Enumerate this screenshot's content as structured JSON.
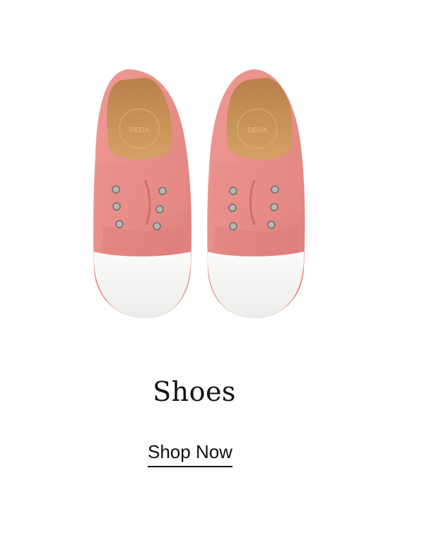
{
  "product": {
    "image_alt": "Pink canvas slip-on shoes with white toe caps",
    "logo_text": "DEDA"
  },
  "category": {
    "title": "Shoes",
    "cta_label": "Shop Now"
  },
  "colors": {
    "canvas": "#e88f8b",
    "toe_cap": "#f6f6f4",
    "lining": "#c99356"
  }
}
